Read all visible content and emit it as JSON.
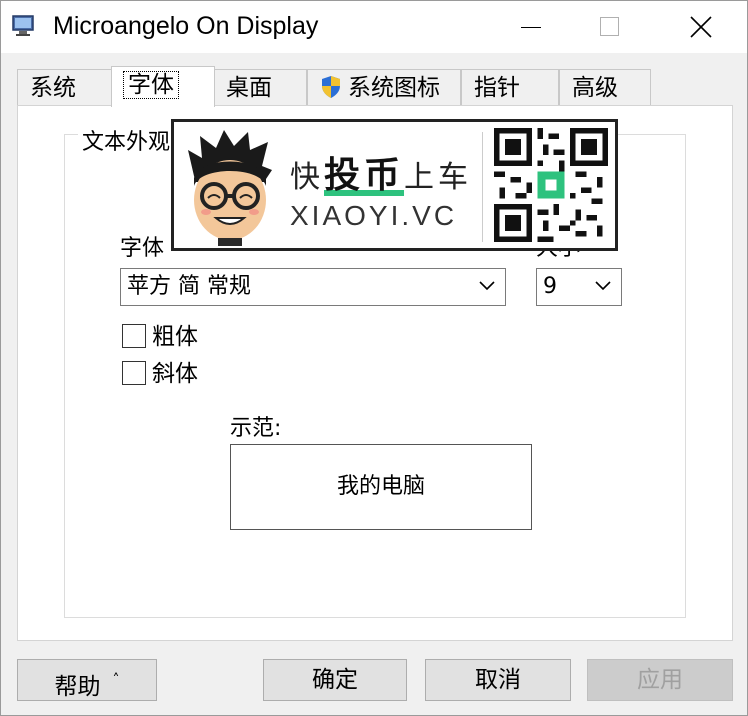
{
  "window": {
    "title": "Microangelo On Display"
  },
  "tabs": [
    {
      "label": "系统",
      "active": false
    },
    {
      "label": "字体",
      "active": true
    },
    {
      "label": "桌面",
      "active": false
    },
    {
      "label": "系统图标",
      "active": false,
      "icon": "shield-icon"
    },
    {
      "label": "指针",
      "active": false
    },
    {
      "label": "高级",
      "active": false
    }
  ],
  "group": {
    "legend": "文本外观"
  },
  "font": {
    "label": "字体",
    "value": "苹方 简 常规"
  },
  "size": {
    "label": "大小",
    "value": "9"
  },
  "checkboxes": [
    {
      "label": "粗体",
      "checked": false
    },
    {
      "label": "斜体",
      "checked": false
    }
  ],
  "sample": {
    "label": "示范:",
    "text": "我的电脑"
  },
  "ad": {
    "line1_pre": "快",
    "line1_highlight": "投币",
    "line1_post": "上车",
    "line2": "XIAOYI.VC"
  },
  "buttons": {
    "help": "帮助",
    "ok": "确定",
    "cancel": "取消",
    "apply": "应用"
  }
}
